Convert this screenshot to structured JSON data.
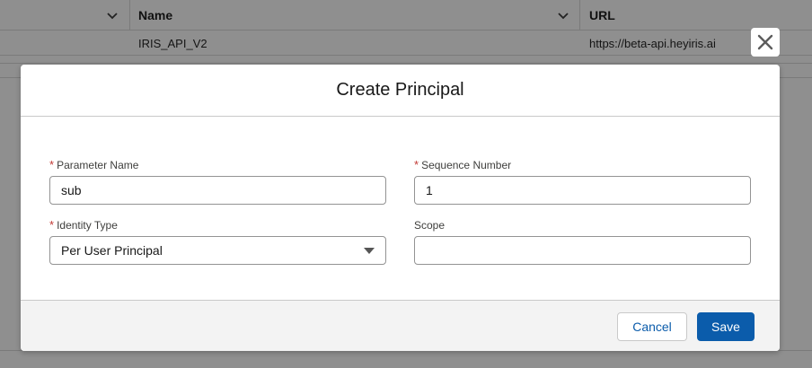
{
  "background_table": {
    "columns": [
      {
        "label": ""
      },
      {
        "label": "Name"
      },
      {
        "label": "URL"
      }
    ],
    "rows": [
      {
        "name": "IRIS_API_V2",
        "url": "https://beta-api.heyiris.ai"
      }
    ]
  },
  "modal": {
    "title": "Create Principal",
    "close_icon": "close-icon",
    "fields": {
      "parameter_name": {
        "label": "Parameter Name",
        "required": "*",
        "value": "sub"
      },
      "sequence_number": {
        "label": "Sequence Number",
        "required": "*",
        "value": "1"
      },
      "identity_type": {
        "label": "Identity Type",
        "required": "*",
        "value": "Per User Principal"
      },
      "scope": {
        "label": "Scope",
        "value": ""
      }
    },
    "footer": {
      "cancel_label": "Cancel",
      "save_label": "Save"
    }
  },
  "colors": {
    "brand": "#0b5cab",
    "required": "#c23934",
    "overlay": "#8f8f8f"
  }
}
